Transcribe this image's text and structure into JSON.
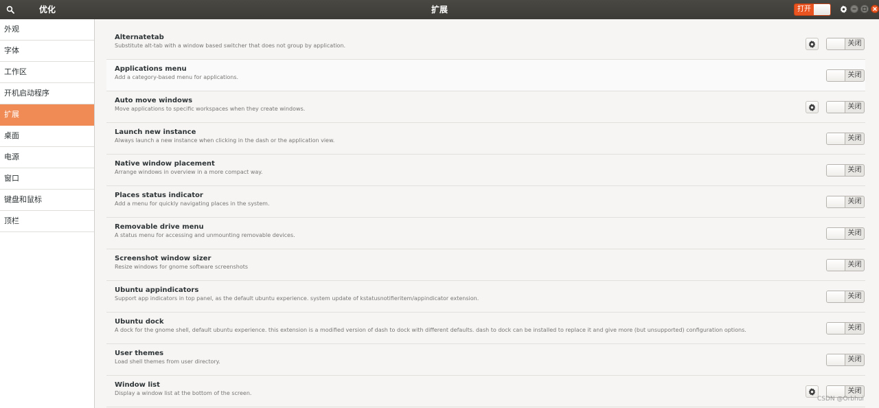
{
  "header": {
    "app_title": "优化",
    "page_title": "扩展",
    "global_switch_label": "打开",
    "global_switch_on": true
  },
  "sidebar": {
    "items": [
      {
        "label": "外观",
        "active": false
      },
      {
        "label": "字体",
        "active": false
      },
      {
        "label": "工作区",
        "active": false
      },
      {
        "label": "开机启动程序",
        "active": false
      },
      {
        "label": "扩展",
        "active": true
      },
      {
        "label": "桌面",
        "active": false
      },
      {
        "label": "电源",
        "active": false
      },
      {
        "label": "窗口",
        "active": false
      },
      {
        "label": "键盘和鼠标",
        "active": false
      },
      {
        "label": "顶栏",
        "active": false
      }
    ]
  },
  "extensions": [
    {
      "name": "Alternatetab",
      "description": "Substitute alt-tab with a window based switcher that does not group by application.",
      "has_settings": true,
      "state_label": "关闭"
    },
    {
      "name": "Applications menu",
      "description": "Add a category-based menu for applications.",
      "has_settings": false,
      "state_label": "关闭"
    },
    {
      "name": "Auto move windows",
      "description": "Move applications to specific workspaces when they create windows.",
      "has_settings": true,
      "state_label": "关闭"
    },
    {
      "name": "Launch new instance",
      "description": "Always launch a new instance when clicking in the dash or the application view.",
      "has_settings": false,
      "state_label": "关闭"
    },
    {
      "name": "Native window placement",
      "description": "Arrange windows in overview in a more compact way.",
      "has_settings": false,
      "state_label": "关闭"
    },
    {
      "name": "Places status indicator",
      "description": "Add a menu for quickly navigating places in the system.",
      "has_settings": false,
      "state_label": "关闭"
    },
    {
      "name": "Removable drive menu",
      "description": "A status menu for accessing and unmounting removable devices.",
      "has_settings": false,
      "state_label": "关闭"
    },
    {
      "name": "Screenshot window sizer",
      "description": "Resize windows for gnome software screenshots",
      "has_settings": false,
      "state_label": "关闭"
    },
    {
      "name": "Ubuntu appindicators",
      "description": "Support app indicators in top panel, as the default ubuntu experience. system update of kstatusnotifieritem/appindicator extension.",
      "has_settings": false,
      "state_label": "关闭"
    },
    {
      "name": "Ubuntu dock",
      "description": "A dock for the gnome shell, default ubuntu experience. this extension is a modified version of dash to dock with different defaults. dash to dock can be installed to replace it and give more (but unsupported) configuration options.",
      "has_settings": false,
      "state_label": "关闭"
    },
    {
      "name": "User themes",
      "description": "Load shell themes from user directory.",
      "has_settings": false,
      "state_label": "关闭"
    },
    {
      "name": "Window list",
      "description": "Display a window list at the bottom of the screen.",
      "has_settings": true,
      "state_label": "关闭"
    }
  ],
  "watermark": "CSDN @Orbhui",
  "icons": {
    "search": "search-icon",
    "gear": "gear-icon",
    "minimize": "minimize-icon",
    "maximize": "maximize-icon",
    "close": "close-icon"
  },
  "colors": {
    "accent": "#e95420",
    "sidebar_active": "#f08b55",
    "header_bg": "#3c3b37"
  }
}
